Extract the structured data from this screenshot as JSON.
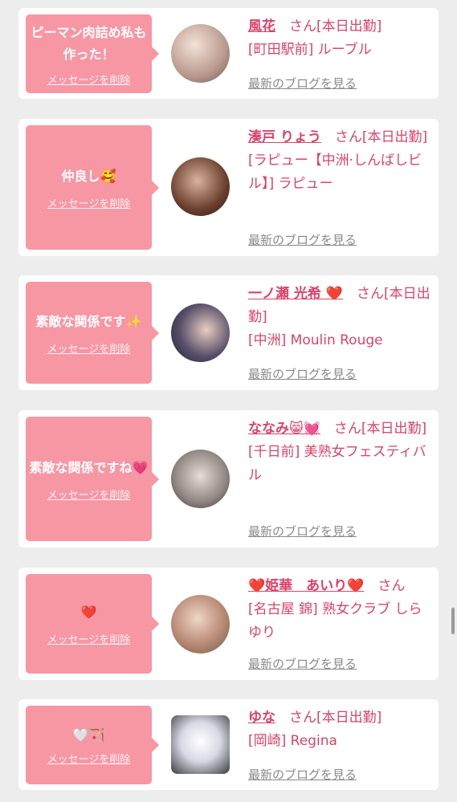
{
  "delete_label": "メッセージを削除",
  "blog_label": "最新のブログを見る",
  "san_label": "さん",
  "colors": {
    "bubble": "#f797a4",
    "accent": "#d9436a",
    "background": "#ededed"
  },
  "cards": [
    {
      "message": "ピーマン肉詰め私も作った！",
      "name": "風花",
      "status": "[本日出勤]",
      "shop": "[町田駅前] ルーブル"
    },
    {
      "message": "仲良し🥰",
      "name": "湊戸 りょう",
      "status": "[本日出勤]",
      "shop": "[ラピュー【中洲·しんばしビル】] ラピュー"
    },
    {
      "message": "素敵な関係です✨",
      "name": "一ノ瀬 光希 ❤️",
      "status": "[本日出勤]",
      "shop": "[中洲] Moulin Rouge"
    },
    {
      "message": "素敵な関係ですね💗",
      "name": "ななみ😸💓",
      "status": "[本日出勤]",
      "shop": "[千日前] 美熟女フェスティバル"
    },
    {
      "message": "❤️",
      "name": "❤️姫華　あいり❤️",
      "status": "",
      "shop": "[名古屋 錦] 熟女クラブ しらゆり"
    },
    {
      "message": "🤍🏹",
      "name": "ゆな",
      "status": "[本日出勤]",
      "shop": "[岡崎] Regina"
    }
  ]
}
